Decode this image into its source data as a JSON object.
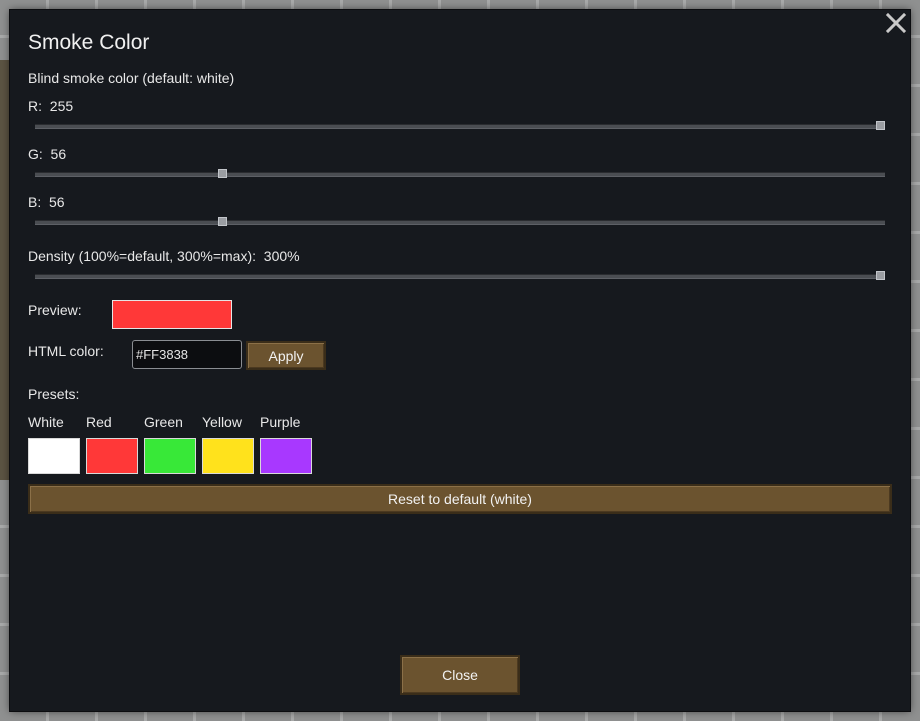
{
  "dialog": {
    "title": "Smoke Color",
    "subtitle": "Blind smoke color (default: white)"
  },
  "sliders": [
    {
      "label": "R:  255",
      "value": 255,
      "max": 255
    },
    {
      "label": "G:  56",
      "value": 56,
      "max": 255
    },
    {
      "label": "B:  56",
      "value": 56,
      "max": 255
    },
    {
      "label": "Density (100%=default, 300%=max):  300%",
      "value": 300,
      "min": 0,
      "max": 300
    }
  ],
  "preview": {
    "label": "Preview:",
    "color": "#FF3838"
  },
  "html_color": {
    "label": "HTML color:",
    "value": "#FF3838",
    "apply_label": "Apply"
  },
  "presets": {
    "label": "Presets:",
    "items": [
      {
        "name": "White",
        "color": "#FFFFFF"
      },
      {
        "name": "Red",
        "color": "#FF3838"
      },
      {
        "name": "Green",
        "color": "#38E838"
      },
      {
        "name": "Yellow",
        "color": "#FFE21C"
      },
      {
        "name": "Purple",
        "color": "#A838FF"
      }
    ]
  },
  "reset_label": "Reset to default (white)",
  "close_label": "Close",
  "icons": {
    "close": "close-icon"
  }
}
